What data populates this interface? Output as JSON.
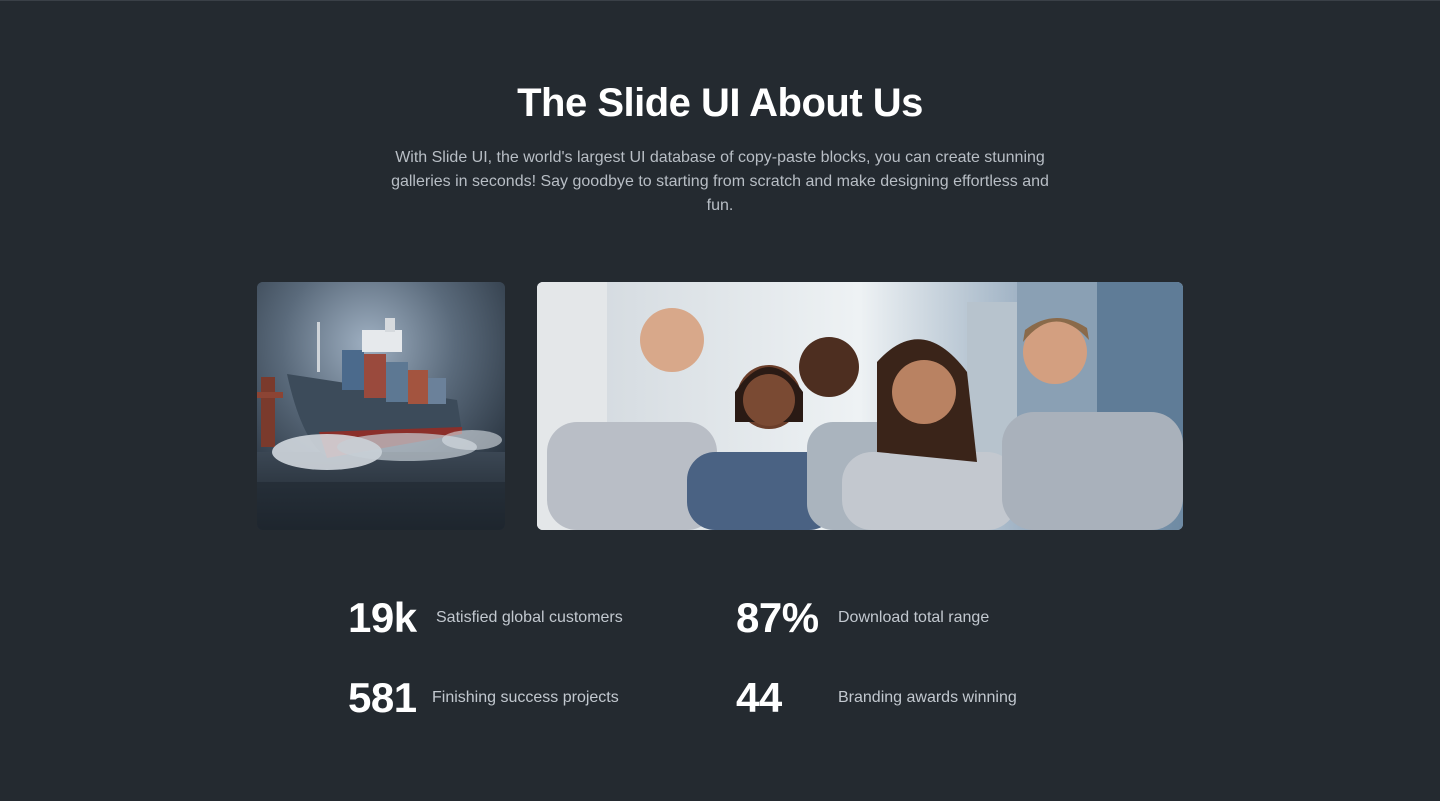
{
  "about": {
    "title": "The Slide UI About Us",
    "description": "With Slide UI, the world's largest UI database of copy-paste blocks, you can create stunning galleries in seconds! Say goodbye to starting from scratch and make designing effortless and fun."
  },
  "gallery": {
    "images": [
      {
        "name": "cargo-ship-photo"
      },
      {
        "name": "team-photo"
      }
    ]
  },
  "stats": [
    {
      "value": "19k",
      "label": "Satisfied global customers"
    },
    {
      "value": "87%",
      "label": "Download total range"
    },
    {
      "value": "581",
      "label": "Finishing success projects"
    },
    {
      "value": "44",
      "label": "Branding awards winning"
    }
  ],
  "colors": {
    "background": "#242a30",
    "title": "#ffffff",
    "body_text": "#b8bec5"
  }
}
